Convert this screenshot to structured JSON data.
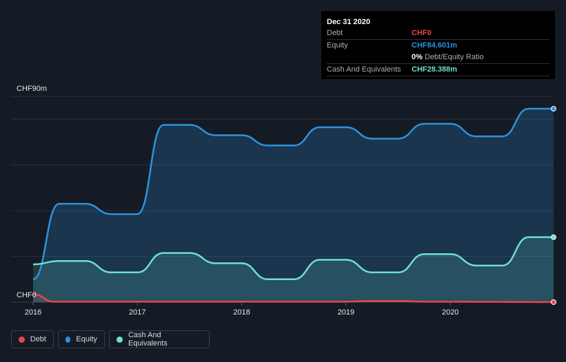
{
  "chart_data": {
    "type": "area",
    "y_top_label": "CHF90m",
    "y_bottom_label": "CHF0",
    "ylim": [
      0,
      90
    ],
    "xlim": [
      2016.0,
      2020.99
    ],
    "x_ticks": [
      "2016",
      "2017",
      "2018",
      "2019",
      "2020"
    ],
    "series": [
      {
        "name": "Debt",
        "color": "#e8454f",
        "x": [
          2016.0,
          2016.2,
          2019.0,
          2019.25,
          2019.5,
          2019.75,
          2020.99
        ],
        "values": [
          3.5,
          0.2,
          0.2,
          0.5,
          0.5,
          0.2,
          0.0
        ]
      },
      {
        "name": "Equity",
        "color": "#2d93e0",
        "x": [
          2016.0,
          2016.25,
          2016.5,
          2016.75,
          2017.0,
          2017.25,
          2017.5,
          2017.75,
          2018.0,
          2018.25,
          2018.5,
          2018.75,
          2019.0,
          2019.25,
          2019.5,
          2019.75,
          2020.0,
          2020.25,
          2020.5,
          2020.75,
          2020.99
        ],
        "values": [
          10,
          43,
          43,
          38.5,
          38.5,
          77.5,
          77.5,
          73,
          73,
          68.5,
          68.5,
          76.5,
          76.5,
          71.5,
          71.5,
          78,
          78,
          72.5,
          72.5,
          84.6,
          84.6
        ]
      },
      {
        "name": "Cash And Equivalents",
        "color": "#6ee0cf",
        "x": [
          2016.0,
          2016.25,
          2016.5,
          2016.75,
          2017.0,
          2017.25,
          2017.5,
          2017.75,
          2018.0,
          2018.25,
          2018.5,
          2018.75,
          2019.0,
          2019.25,
          2019.5,
          2019.75,
          2020.0,
          2020.25,
          2020.5,
          2020.75,
          2020.99
        ],
        "values": [
          16.5,
          18,
          18,
          13,
          13,
          21.5,
          21.5,
          17,
          17,
          10,
          10,
          18.5,
          18.5,
          13,
          13,
          21,
          21,
          16,
          16,
          28.4,
          28.4
        ]
      }
    ],
    "grid": true
  },
  "tooltip": {
    "date": "Dec 31 2020",
    "debt_label": "Debt",
    "debt_value": "CHF0",
    "equity_label": "Equity",
    "equity_value": "CHF84.601m",
    "ratio_value": "0%",
    "ratio_label": "Debt/Equity Ratio",
    "cash_label": "Cash And Equivalents",
    "cash_value": "CHF28.388m"
  },
  "legend": {
    "debt": "Debt",
    "equity": "Equity",
    "cash": "Cash And Equivalents"
  },
  "colors": {
    "debt": "#e8454f",
    "equity": "#2d93e0",
    "cash": "#6ee0cf",
    "background": "#151b24"
  }
}
